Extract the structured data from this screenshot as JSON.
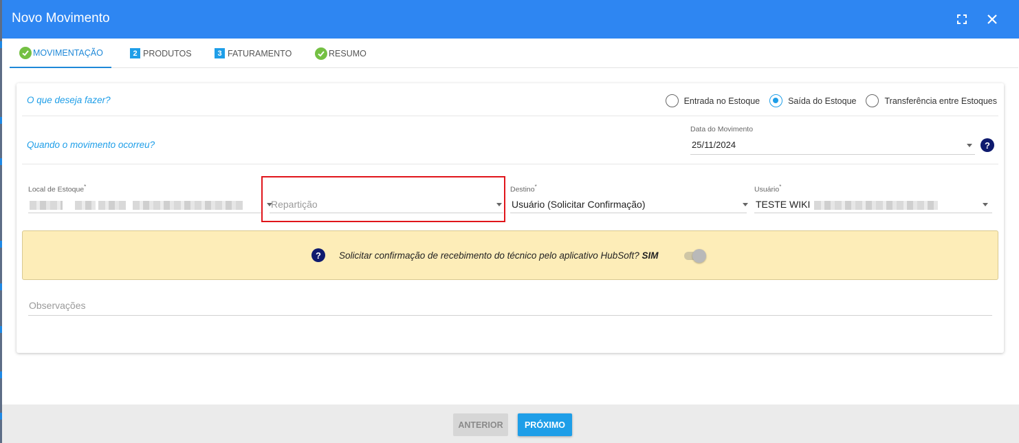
{
  "dialog": {
    "title": "Novo Movimento",
    "icons": {
      "fullscreen": "fullscreen-icon",
      "close": "close-icon"
    }
  },
  "tabs": [
    {
      "label": "MOVIMENTAÇÃO",
      "marker": "check-icon",
      "active": true
    },
    {
      "label": "PRODUTOS",
      "marker": "2"
    },
    {
      "label": "FATURAMENTO",
      "marker": "3"
    },
    {
      "label": "RESUMO",
      "marker": "check-icon"
    }
  ],
  "what": {
    "question": "O que deseja fazer?",
    "options": [
      {
        "label": "Entrada no Estoque",
        "selected": false
      },
      {
        "label": "Saída do Estoque",
        "selected": true
      },
      {
        "label": "Transferência entre Estoques",
        "selected": false
      }
    ]
  },
  "when": {
    "question": "Quando o movimento ocorreu?",
    "date_label": "Data do Movimento",
    "date_value": "25/11/2024",
    "help": "?"
  },
  "fields": {
    "local": {
      "label": "Local de Estoque",
      "required": "*"
    },
    "reparticao": {
      "placeholder": "Repartição"
    },
    "destino": {
      "label": "Destino",
      "required": "*",
      "value": "Usuário (Solicitar Confirmação)"
    },
    "usuario": {
      "label": "Usuário",
      "required": "*",
      "value": "TESTE WIKI"
    }
  },
  "confirmation": {
    "help": "?",
    "text": "Solicitar confirmação de recebimento do técnico pelo aplicativo HubSoft?",
    "value": "SIM",
    "toggle_on": true
  },
  "observacoes": {
    "placeholder": "Observações"
  },
  "footer": {
    "prev": "ANTERIOR",
    "next": "PRÓXIMO"
  },
  "colors": {
    "header": "#2e86f2",
    "accent": "#1e9ee8",
    "alert_bg": "#fdedb8",
    "highlight": "#e0141a",
    "check": "#74c043"
  }
}
